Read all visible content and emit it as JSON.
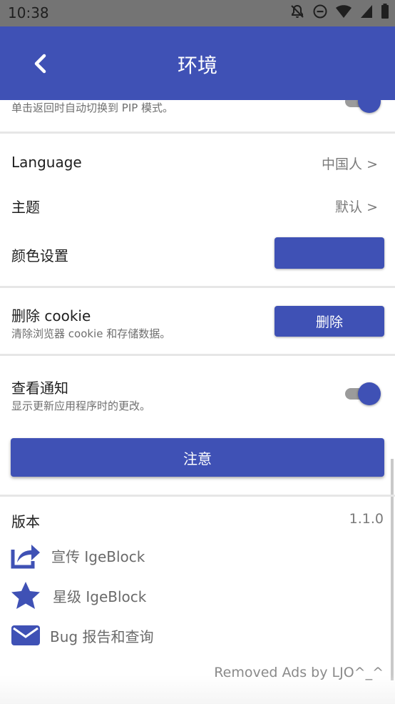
{
  "status_bar": {
    "time": "10:38"
  },
  "app_bar": {
    "title": "环境"
  },
  "pip": {
    "description": "单击返回时自动切换到 PIP 模式。",
    "enabled": true
  },
  "language": {
    "label": "Language",
    "value": "中国人 >"
  },
  "theme": {
    "label": "主题",
    "value": "默认 >"
  },
  "color_settings": {
    "label": "颜色设置",
    "color": "#3f51b5"
  },
  "cookie": {
    "label": "删除 cookie",
    "description": "清除浏览器 cookie 和存储数据。",
    "button": "删除"
  },
  "notifications": {
    "label": "查看通知",
    "description": "显示更新应用程序时的更改。",
    "enabled": true,
    "button": "注意"
  },
  "version": {
    "label": "版本",
    "value": "1.1.0"
  },
  "links": [
    {
      "label": "宣传 IgeBlock",
      "icon": "share-icon"
    },
    {
      "label": "星级 IgeBlock",
      "icon": "star-icon"
    },
    {
      "label": "Bug 报告和查询",
      "icon": "mail-icon"
    }
  ],
  "footer": {
    "text": "Removed Ads by LJO^_^"
  },
  "colors": {
    "primary": "#3f51b5",
    "status_bar": "#747474"
  }
}
